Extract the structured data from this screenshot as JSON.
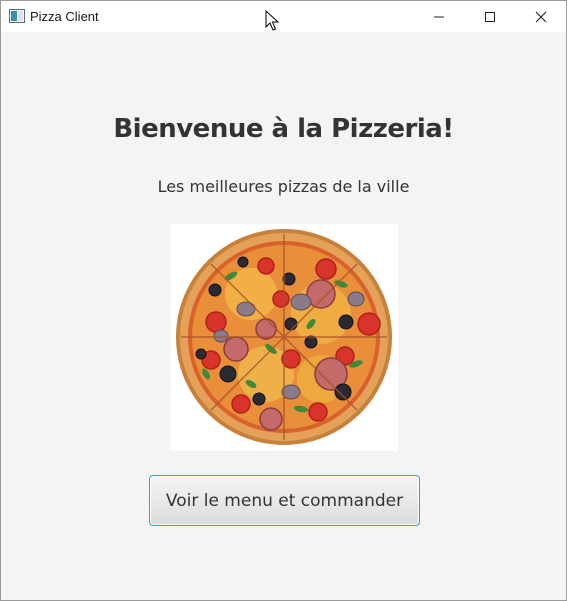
{
  "window": {
    "title": "Pizza Client",
    "app_icon": "java-window-icon",
    "controls": [
      "minimize-icon",
      "maximize-icon",
      "close-icon"
    ]
  },
  "main": {
    "heading": "Bienvenue à la Pizzeria!",
    "subtitle": "Les meilleures pizzas de la ville",
    "image": "pizza-image",
    "cta_label": "Voir le menu et commander"
  },
  "colors": {
    "background": "#f4f4f4",
    "titlebar": "#ffffff",
    "text": "#333333",
    "button_focus_border": "#2d9fd8"
  }
}
